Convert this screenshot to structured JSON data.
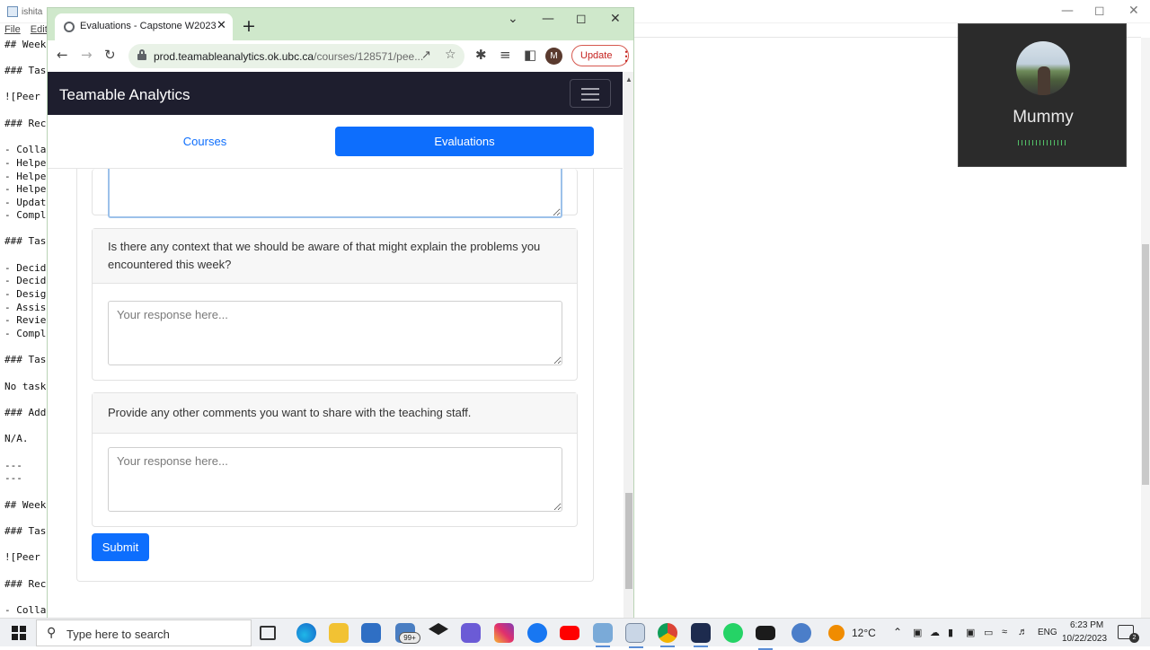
{
  "notepad": {
    "title": "ishita",
    "menu": [
      "File",
      "Edit"
    ],
    "lines": [
      "## Week",
      "### Tas",
      "![Peer",
      "### Rec",
      "- Colla",
      "- Helpe",
      "- Helpe",
      "- Helpe",
      "- Updat",
      "- Compl",
      "### Tas",
      "- Decid",
      "- Decid",
      "- Desig",
      "- Assis",
      "- Revie",
      "- Compl",
      "### Tas",
      "No task",
      "### Add",
      "N/A.",
      "---",
      "---",
      "## Week",
      "### Tas",
      "![Peer",
      "### Rec",
      "- Colla"
    ]
  },
  "video_call": {
    "participant_name": "Mummy"
  },
  "browser": {
    "tab_title": "Evaluations - Capstone W2023",
    "url_host": "prod.teamableanalytics.ok.ubc.ca",
    "url_path": "/courses/128571/pee...",
    "profile_initial": "M",
    "update_label": "Update"
  },
  "page": {
    "brand": "Teamable Analytics",
    "nav": {
      "courses": "Courses",
      "evaluations": "Evaluations"
    },
    "questions": [
      {
        "prompt": "Is there any context that we should be aware of that might explain the problems you encountered this week?",
        "placeholder": "Your response here..."
      },
      {
        "prompt": "Provide any other comments you want to share with the teaching staff.",
        "placeholder": "Your response here..."
      }
    ],
    "submit_label": "Submit"
  },
  "taskbar": {
    "search_placeholder": "Type here to search",
    "badge": "99+",
    "temperature": "12°C",
    "language": "ENG",
    "time": "6:23 PM",
    "date": "10/22/2023",
    "notification_count": "2"
  }
}
